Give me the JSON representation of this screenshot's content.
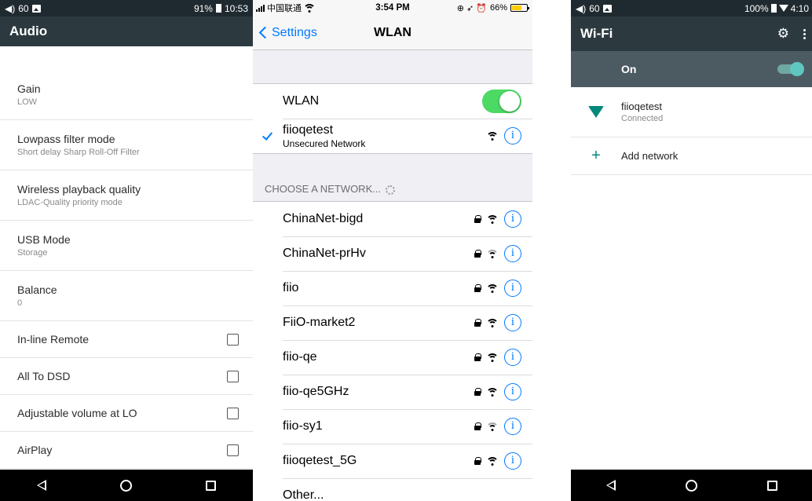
{
  "audio_panel": {
    "status": {
      "volume": "60",
      "battery": "91%",
      "time": "10:53"
    },
    "title": "Audio",
    "items": [
      {
        "title": "Gain",
        "subtitle": "LOW"
      },
      {
        "title": "Lowpass filter mode",
        "subtitle": "Short delay Sharp Roll-Off Filter"
      },
      {
        "title": "Wireless playback quality",
        "subtitle": "LDAC-Quality priority mode"
      },
      {
        "title": "USB Mode",
        "subtitle": "Storage"
      },
      {
        "title": "Balance",
        "subtitle": "0"
      }
    ],
    "checkbox_items": [
      {
        "title": "In-line Remote",
        "checked": false
      },
      {
        "title": "All To DSD",
        "checked": false
      },
      {
        "title": "Adjustable volume at LO",
        "checked": false
      },
      {
        "title": "AirPlay",
        "checked": false
      }
    ]
  },
  "wlan_panel": {
    "status": {
      "carrier": "中国联通",
      "time": "3:54 PM",
      "battery": "66%"
    },
    "back_label": "Settings",
    "title": "WLAN",
    "wlan_label": "WLAN",
    "wlan_on": true,
    "connected": {
      "name": "fiioqetest",
      "subtitle": "Unsecured Network"
    },
    "section_header": "CHOOSE A NETWORK...",
    "networks": [
      {
        "name": "ChinaNet-bigd",
        "locked": true
      },
      {
        "name": "ChinaNet-prHv",
        "locked": true
      },
      {
        "name": "fiio",
        "locked": true
      },
      {
        "name": "FiiO-market2",
        "locked": true
      },
      {
        "name": "fiio-qe",
        "locked": true
      },
      {
        "name": "fiio-qe5GHz",
        "locked": true
      },
      {
        "name": "fiio-sy1",
        "locked": true
      },
      {
        "name": "fiioqetest_5G",
        "locked": true
      }
    ],
    "other_label": "Other..."
  },
  "wifi_panel": {
    "status": {
      "volume": "60",
      "battery": "100%",
      "time": "4:10"
    },
    "title": "Wi-Fi",
    "on_label": "On",
    "network": {
      "name": "fiioqetest",
      "status": "Connected"
    },
    "add_label": "Add network"
  },
  "colors": {
    "android_appbar": "#2c3a40",
    "android_statusbar": "#1f2a30",
    "ios_blue": "#007aff",
    "ios_green": "#4cd964",
    "teal": "#00897b"
  }
}
